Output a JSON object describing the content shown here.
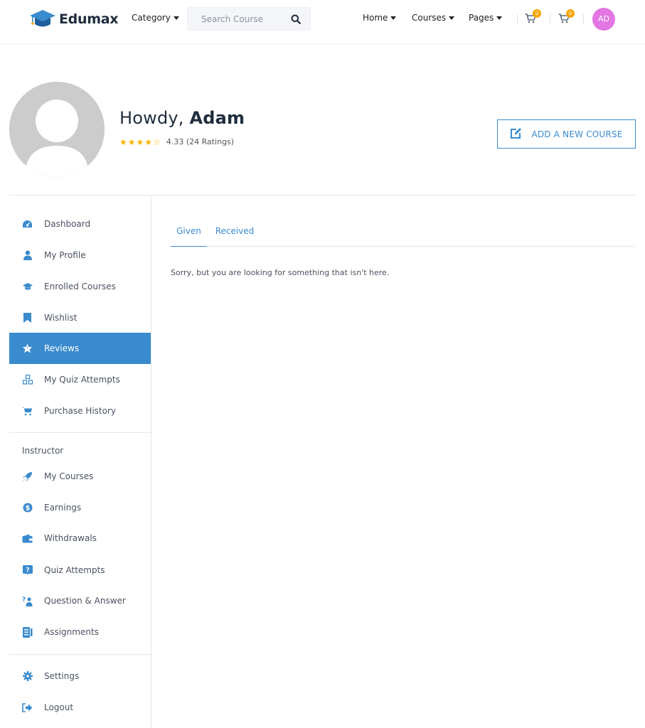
{
  "header": {
    "brand": "Edumax",
    "category_label": "Category",
    "search_placeholder": "Search Course",
    "nav": {
      "home": "Home",
      "courses": "Courses",
      "pages": "Pages"
    },
    "cart_count_1": "0",
    "cart_count_2": "0",
    "avatar_initials": "AD"
  },
  "profile": {
    "greeting": "Howdy,",
    "name": "Adam",
    "rating_text": "4.33 (24 Ratings)",
    "stars_filled": 4,
    "stars_total": 5,
    "add_course_label": "ADD A NEW COURSE"
  },
  "sidebar": {
    "items": [
      {
        "label": "Dashboard",
        "icon": "dashboard-icon"
      },
      {
        "label": "My Profile",
        "icon": "user-icon"
      },
      {
        "label": "Enrolled Courses",
        "icon": "graduation-cap-icon"
      },
      {
        "label": "Wishlist",
        "icon": "bookmark-icon"
      },
      {
        "label": "Reviews",
        "icon": "star-icon",
        "active": true
      },
      {
        "label": "My Quiz Attempts",
        "icon": "quiz-icon"
      },
      {
        "label": "Purchase History",
        "icon": "cart-icon"
      }
    ],
    "instructor_heading": "Instructor",
    "instructor_items": [
      {
        "label": "My Courses",
        "icon": "rocket-icon"
      },
      {
        "label": "Earnings",
        "icon": "dollar-icon"
      },
      {
        "label": "Withdrawals",
        "icon": "wallet-icon"
      },
      {
        "label": "Quiz Attempts",
        "icon": "question-box-icon"
      },
      {
        "label": "Question & Answer",
        "icon": "qa-icon"
      },
      {
        "label": "Assignments",
        "icon": "assignment-icon"
      }
    ],
    "footer_items": [
      {
        "label": "Settings",
        "icon": "gear-icon"
      },
      {
        "label": "Logout",
        "icon": "logout-icon"
      }
    ]
  },
  "content": {
    "tabs": [
      {
        "label": "Given",
        "active": true
      },
      {
        "label": "Received",
        "active": false
      }
    ],
    "empty_message": "Sorry, but you are looking for something that isn't here."
  },
  "colors": {
    "accent": "#3a8bcd",
    "star": "#f7b500",
    "badge": "#f6a609",
    "avatar_bg": "#e276e3"
  }
}
